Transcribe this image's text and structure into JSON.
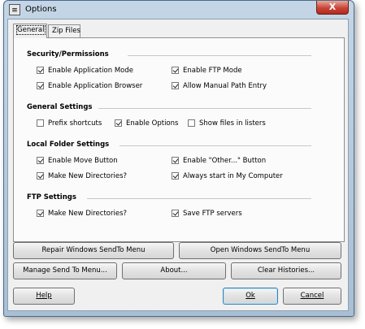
{
  "window": {
    "title": "Options",
    "close_glyph": "X",
    "app_icon": "app-icon"
  },
  "tabs": [
    {
      "label": "General",
      "active": true
    },
    {
      "label": "Zip Files",
      "active": false
    }
  ],
  "groups": [
    {
      "title": "Security/Permissions",
      "items": [
        {
          "label": "Enable Application Mode",
          "checked": true
        },
        {
          "label": "Enable FTP Mode",
          "checked": true
        },
        {
          "label": "Enable Application Browser",
          "checked": true
        },
        {
          "label": "Allow Manual Path Entry",
          "checked": true
        }
      ]
    },
    {
      "title": "General Settings",
      "items": [
        {
          "label": "Prefix shortcuts",
          "checked": false
        },
        {
          "label": "Enable Options",
          "checked": true
        },
        {
          "label": "Show files in listers",
          "checked": false
        }
      ]
    },
    {
      "title": "Local Folder Settings",
      "items": [
        {
          "label": "Enable Move Button",
          "checked": true
        },
        {
          "label": "Enable \"Other...\" Button",
          "checked": true
        },
        {
          "label": "Make New Directories?",
          "checked": true
        },
        {
          "label": "Always start in My Computer",
          "checked": true
        }
      ]
    },
    {
      "title": "FTP Settings",
      "items": [
        {
          "label": "Make New Directories?",
          "checked": true
        },
        {
          "label": "Save FTP servers",
          "checked": true
        }
      ]
    }
  ],
  "buttons": {
    "repair": "Repair Windows SendTo Menu",
    "open": "Open Windows SendTo Menu",
    "manage": "Manage Send To Menu...",
    "about": "About...",
    "clear": "Clear Histories...",
    "help": "Help",
    "ok": "Ok",
    "cancel": "Cancel"
  }
}
